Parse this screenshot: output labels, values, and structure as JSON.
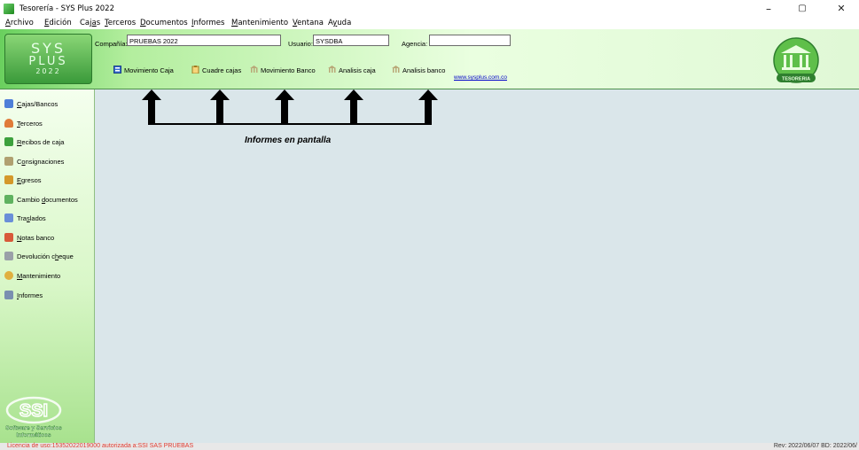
{
  "window": {
    "title": "Tesorería - SYS Plus 2022",
    "controls": {
      "minimize": "–",
      "maximize": "▢",
      "close": "✕"
    }
  },
  "menu": [
    {
      "pre": "",
      "key": "A",
      "post": "rchivo"
    },
    {
      "pre": "",
      "key": "E",
      "post": "dición"
    },
    {
      "pre": "Caj",
      "key": "a",
      "post": "s"
    },
    {
      "pre": "",
      "key": "T",
      "post": "erceros"
    },
    {
      "pre": "",
      "key": "D",
      "post": "ocumentos"
    },
    {
      "pre": "",
      "key": "I",
      "post": "nformes"
    },
    {
      "pre": "",
      "key": "M",
      "post": "antenimiento"
    },
    {
      "pre": "",
      "key": "V",
      "post": "entana"
    },
    {
      "pre": "A",
      "key": "y",
      "post": "uda"
    }
  ],
  "logo": {
    "line1": "SYS",
    "line2": "PLUS",
    "line3": "2022"
  },
  "fields": {
    "compania": {
      "label": "Compañía:",
      "value": "PRUEBAS 2022"
    },
    "usuario": {
      "label": "Usuario:",
      "value": "SYSDBA"
    },
    "agencia": {
      "label": "Agencia:",
      "value": ""
    }
  },
  "toolbar": [
    {
      "label": "Movimiento Caja",
      "icon": "ledger-icon"
    },
    {
      "label": "Cuadre cajas",
      "icon": "clipboard-icon"
    },
    {
      "label": "Movimiento Banco",
      "icon": "bank-icon"
    },
    {
      "label": "Analisis caja",
      "icon": "bank-icon"
    },
    {
      "label": "Analisis banco",
      "icon": "bank-icon"
    }
  ],
  "website": "www.sysplus.com.co",
  "tesoreria_badge": "TESORERIA",
  "sidebar": [
    {
      "pre": "",
      "key": "C",
      "post": "ajas/Bancos",
      "icon": "ledger-icon",
      "color": "#4f7fd8"
    },
    {
      "pre": "",
      "key": "T",
      "post": "erceros",
      "icon": "person-icon",
      "color": "#e07b39"
    },
    {
      "pre": "",
      "key": "R",
      "post": "ecibos de caja",
      "icon": "money-icon",
      "color": "#3da13d"
    },
    {
      "pre": "C",
      "key": "o",
      "post": "nsignaciones",
      "icon": "bank-icon",
      "color": "#b0a070"
    },
    {
      "pre": "",
      "key": "E",
      "post": "gresos",
      "icon": "money-icon",
      "color": "#d4982a"
    },
    {
      "pre": "Cambio ",
      "key": "d",
      "post": "ocumentos",
      "icon": "exchange-icon",
      "color": "#5fb25f"
    },
    {
      "pre": "Tra",
      "key": "s",
      "post": "lados",
      "icon": "transfer-icon",
      "color": "#6a8fd8"
    },
    {
      "pre": "",
      "key": "N",
      "post": "otas banco",
      "icon": "notes-icon",
      "color": "#d85a3a"
    },
    {
      "pre": "Devolución c",
      "key": "h",
      "post": "eque",
      "icon": "return-icon",
      "color": "#9aa0a8"
    },
    {
      "pre": "",
      "key": "M",
      "post": "antenimiento",
      "icon": "gear-icon",
      "color": "#e0b040"
    },
    {
      "pre": "",
      "key": "I",
      "post": "nformes",
      "icon": "printer-icon",
      "color": "#7a8fb0"
    }
  ],
  "ssi_logo": {
    "mark": "SSI",
    "line1": "Software y Servicios",
    "line2": "Informáticos"
  },
  "annotation": {
    "label": "Informes en pantalla"
  },
  "status": {
    "license": "Licencia de uso:15352022019000 autorizada a:SSI SAS PRUEBAS",
    "revision": "Rev: 2022/06/07 BD: 2022/06/"
  },
  "colors": {
    "accent_green": "#3a9a3a",
    "license_red": "#e03a2f",
    "link_blue": "#0000c8"
  }
}
